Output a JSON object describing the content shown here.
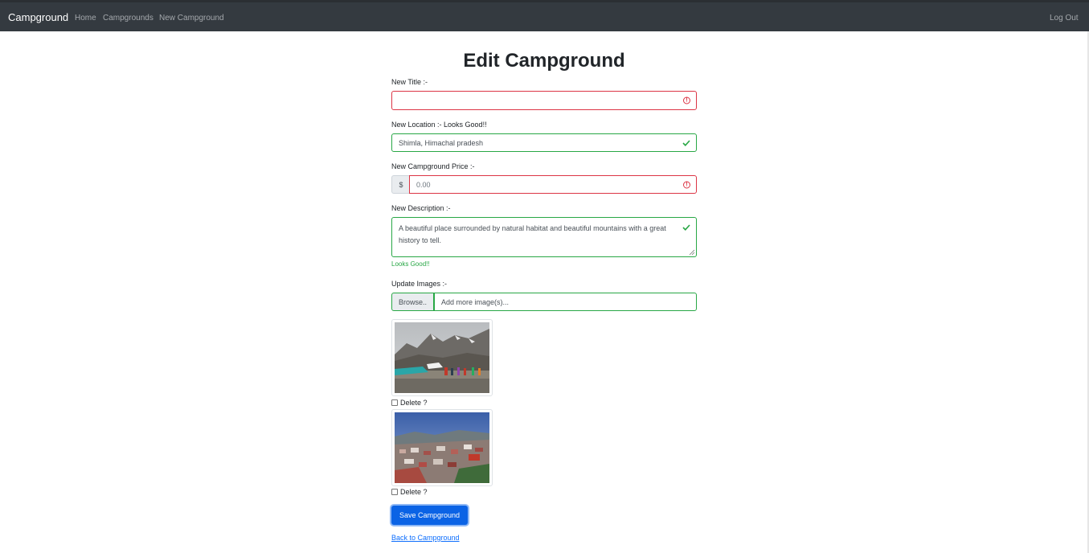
{
  "navbar": {
    "brand": "Campground",
    "links": [
      "Home",
      "Campgrounds",
      "New Campground"
    ],
    "logout": "Log Out"
  },
  "page": {
    "title": "Edit Campground"
  },
  "form": {
    "title_label": "New Title :-",
    "title_value": "",
    "location_label": "New Location :- Looks Good!!",
    "location_value": "Shimla, Himachal pradesh",
    "price_label": "New Campground Price :-",
    "price_prefix": "$",
    "price_placeholder": "0.00",
    "description_label": "New Description :-",
    "description_value": "A beautiful place surrounded by natural habitat and beautiful mountains with a great history to tell.",
    "description_feedback": "Looks Good!!",
    "images_label": "Update Images :-",
    "browse_label": "Browse..",
    "file_placeholder": "Add more image(s)...",
    "delete_label": "Delete ?",
    "save_label": "Save Campground",
    "back_label": "Back to Campground"
  },
  "colors": {
    "navbar_bg": "#343a40",
    "invalid": "#dc3545",
    "valid": "#28a745",
    "primary": "#0b63e5"
  }
}
